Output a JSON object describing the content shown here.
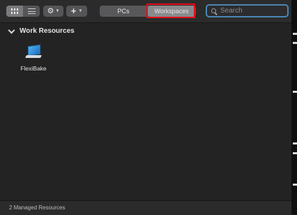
{
  "toolbar": {
    "view_modes": [
      {
        "name": "grid-view",
        "active": true
      },
      {
        "name": "list-view",
        "active": false
      }
    ],
    "action_menu_icon": "gear-icon",
    "add_menu_icon": "plus-icon",
    "tabs": [
      {
        "label": "PCs",
        "selected": false
      },
      {
        "label": "Workspaces",
        "selected": true
      }
    ],
    "search": {
      "placeholder": "Search",
      "value": ""
    }
  },
  "sections": [
    {
      "title": "Work Resources",
      "expanded": true,
      "items": [
        {
          "label": "FlexiBake",
          "icon": "laptop-icon"
        }
      ]
    }
  ],
  "status": {
    "text": "2 Managed Resources"
  },
  "colors": {
    "highlight": "#e60c18",
    "search_focus": "#4b86b4",
    "background": "#232323"
  }
}
